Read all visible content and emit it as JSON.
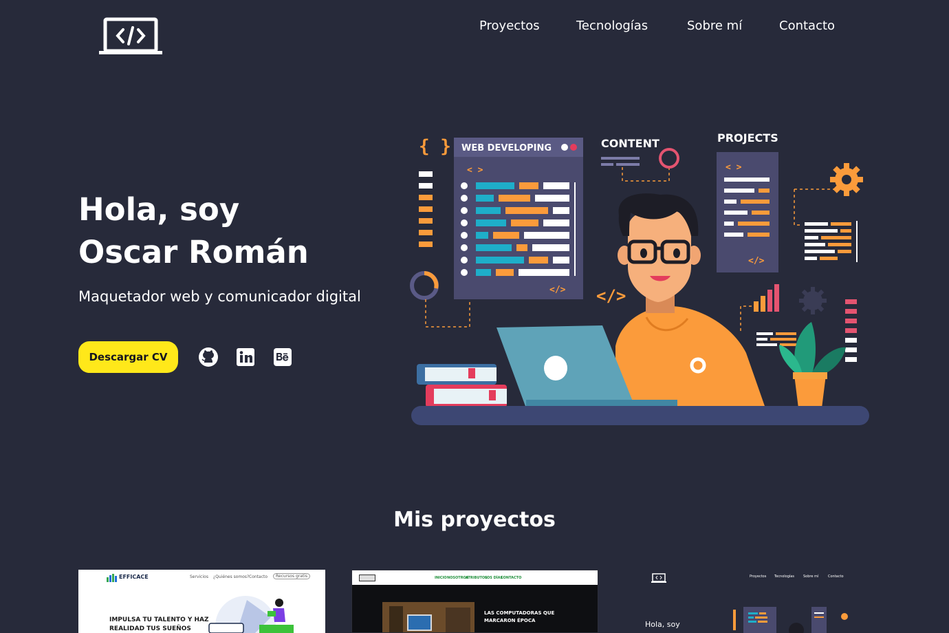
{
  "nav": {
    "logo_icon": "code-laptop-icon",
    "items": [
      {
        "label": "Proyectos"
      },
      {
        "label": "Tecnologías"
      },
      {
        "label": "Sobre mí"
      },
      {
        "label": "Contacto"
      }
    ]
  },
  "hero": {
    "greeting": "Hola, soy",
    "name": "Oscar Román",
    "subtitle": "Maquetador web y comunicador digital",
    "cv_button": "Descargar CV",
    "social": [
      "github-icon",
      "linkedin-icon",
      "behance-icon"
    ],
    "illustration": {
      "panel_web": "WEB DEVELOPING",
      "panel_content": "CONTENT",
      "panel_projects": "PROJECTS",
      "code_open": "< >",
      "code_close": "</>",
      "braces": "{ }"
    }
  },
  "projects": {
    "title": "Mis proyectos",
    "cards": [
      {
        "logo": "EFFICACE",
        "menu": [
          "Servicios",
          "¿Quiénes somos?",
          "Contacto",
          "Recursos gratis"
        ],
        "headline_1": "IMPULSA TU TALENTO Y HAZ",
        "headline_2": "REALIDAD TUS SUEÑOS"
      },
      {
        "menu": [
          "INICIO",
          "NOSOTROS",
          "ATRIBUTOS",
          "LOS DÍAS",
          "CONTACTO"
        ],
        "headline_1": "LAS COMPUTADORAS QUE",
        "headline_2": "MARCARON ÉPOCA"
      },
      {
        "menu": [
          "Proyectos",
          "Tecnologías",
          "Sobre mí",
          "Contacto"
        ],
        "headline": "Hola, soy"
      }
    ]
  },
  "colors": {
    "background": "#272a3a",
    "accent_yellow": "#ffe81a",
    "accent_orange": "#fb9b3b",
    "accent_teal": "#1eaec9",
    "panel": "#4a4a6e"
  }
}
